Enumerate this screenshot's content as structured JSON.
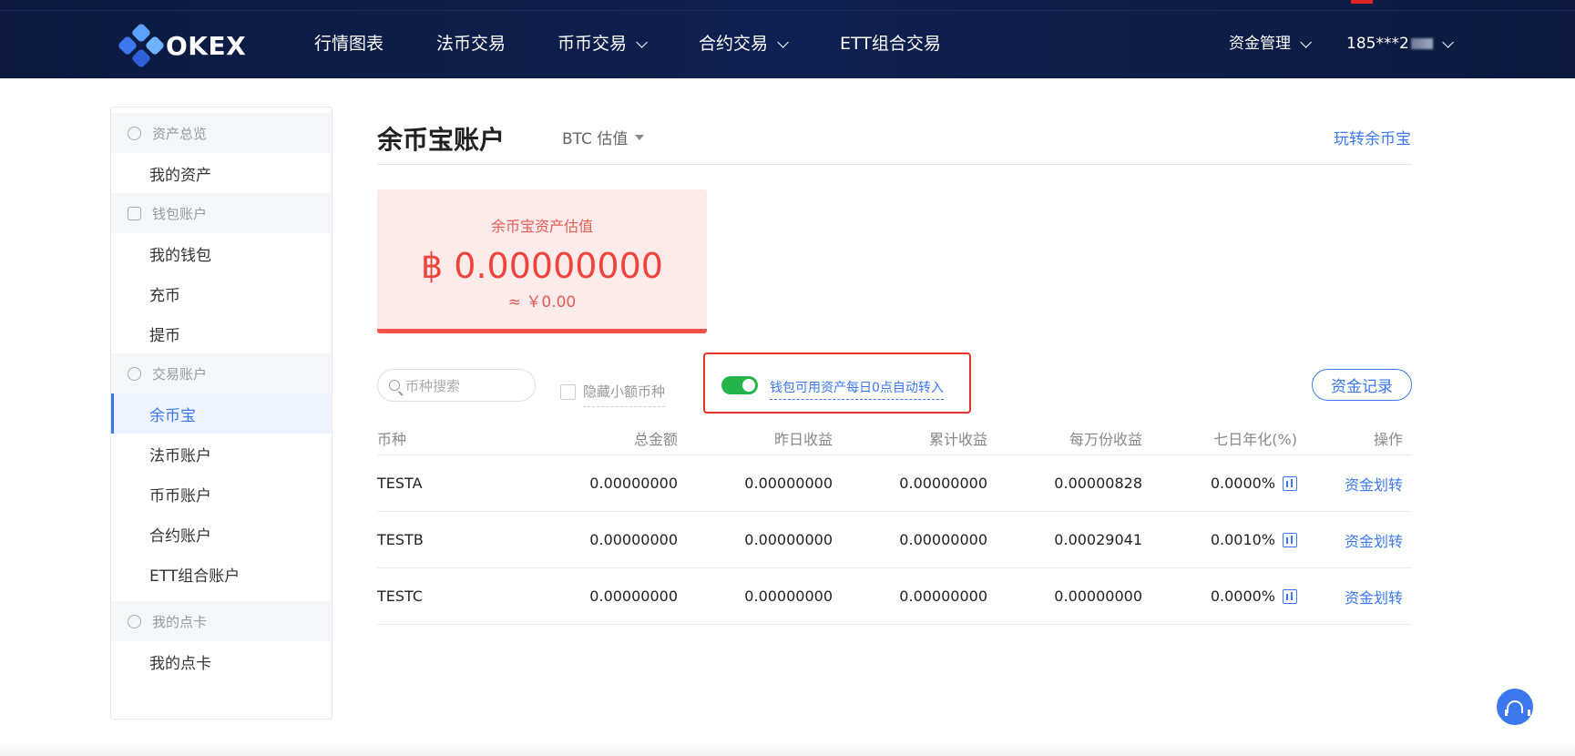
{
  "colors": {
    "nav_bg": "#0e2052",
    "accent": "#3b78f0",
    "danger": "#f0433b",
    "toggle_on": "#25b44b"
  },
  "header": {
    "logo_text": "OKEX",
    "nav": [
      {
        "label": "行情图表",
        "has_dropdown": false
      },
      {
        "label": "法币交易",
        "has_dropdown": false
      },
      {
        "label": "币币交易",
        "has_dropdown": true
      },
      {
        "label": "合约交易",
        "has_dropdown": true
      },
      {
        "label": "ETT组合交易",
        "has_dropdown": false
      }
    ],
    "funds_menu": "资金管理",
    "user": "185***2"
  },
  "sidebar": {
    "groups": [
      {
        "title": "资产总览",
        "icon": "clock-icon",
        "items": [
          {
            "label": "我的资产",
            "active": false
          }
        ]
      },
      {
        "title": "钱包账户",
        "icon": "wallet-icon",
        "items": [
          {
            "label": "我的钱包",
            "active": false
          },
          {
            "label": "充币",
            "active": false
          },
          {
            "label": "提币",
            "active": false
          }
        ]
      },
      {
        "title": "交易账户",
        "icon": "exchange-icon",
        "items": [
          {
            "label": "余币宝",
            "active": true
          },
          {
            "label": "法币账户",
            "active": false
          },
          {
            "label": "币币账户",
            "active": false
          },
          {
            "label": "合约账户",
            "active": false
          },
          {
            "label": "ETT组合账户",
            "active": false
          }
        ]
      },
      {
        "title": "我的点卡",
        "icon": "card-icon",
        "items": [
          {
            "label": "我的点卡",
            "active": false
          }
        ]
      }
    ]
  },
  "main": {
    "title": "余币宝账户",
    "valuation_select": "BTC 估值",
    "play_link": "玩转余币宝",
    "asset_card": {
      "label": "余币宝资产估值",
      "value": "฿ 0.00000000",
      "cny": "≈ ￥0.00"
    },
    "search": {
      "placeholder": "币种搜索"
    },
    "hide_small_label": "隐藏小额币种",
    "auto_transfer": {
      "enabled": true,
      "label": "钱包可用资产每日0点自动转入"
    },
    "records_button": "资金记录",
    "table": {
      "headers": [
        "币种",
        "总金额",
        "昨日收益",
        "累计收益",
        "每万份收益",
        "七日年化(%)",
        "操作"
      ],
      "rows": [
        {
          "coin": "TESTA",
          "total": "0.00000000",
          "yesterday": "0.00000000",
          "cumulative": "0.00000000",
          "per_10k": "0.00000828",
          "annual": "0.0000%",
          "action": "资金划转"
        },
        {
          "coin": "TESTB",
          "total": "0.00000000",
          "yesterday": "0.00000000",
          "cumulative": "0.00000000",
          "per_10k": "0.00029041",
          "annual": "0.0010%",
          "action": "资金划转"
        },
        {
          "coin": "TESTC",
          "total": "0.00000000",
          "yesterday": "0.00000000",
          "cumulative": "0.00000000",
          "per_10k": "0.00000000",
          "annual": "0.0000%",
          "action": "资金划转"
        }
      ]
    }
  }
}
